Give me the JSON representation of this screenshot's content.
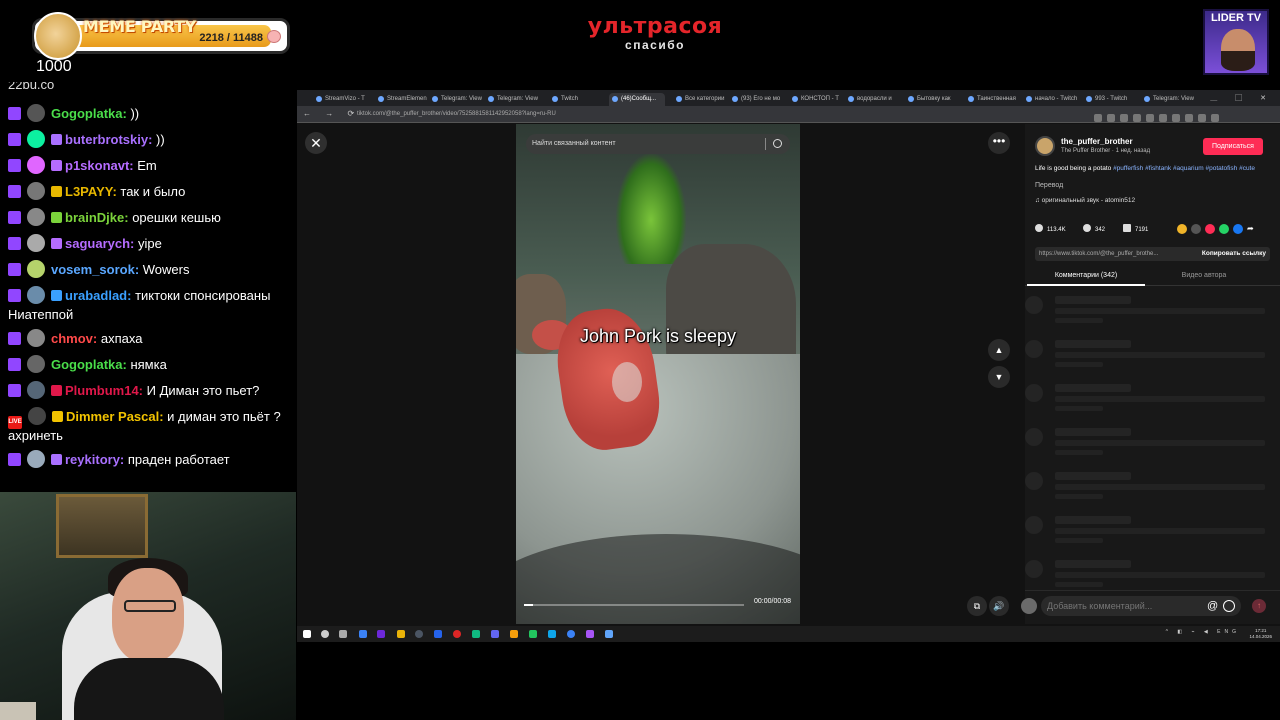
{
  "overlay": {
    "meme_title": "MEME PARTY",
    "meme_count": "2218 / 11488",
    "counter_value": "1000",
    "brand_title": "ультрасоя",
    "brand_subtitle": "спасибо",
    "channel_badge": "LIDER TV"
  },
  "chat": {
    "top_partial": "22bu.co",
    "messages": [
      {
        "user": "Gogoplatka",
        "color": "#4ade4a",
        "text": " ))"
      },
      {
        "user": "buterbrotskiy",
        "color": "#a970ff",
        "text": " ))"
      },
      {
        "user": "p1skonavt",
        "color": "#b56cff",
        "text": " Em"
      },
      {
        "user": "L3PAYY",
        "color": "#e8b800",
        "text": " так и было"
      },
      {
        "user": "brainDjke",
        "color": "#7bd33b",
        "text": " орешки кешью"
      },
      {
        "user": "saguarych",
        "color": "#b56cff",
        "text": " yipe"
      },
      {
        "user": "vosem_sorok",
        "color": "#5aa7ff",
        "text": " Wowers"
      },
      {
        "user": "urabadlad",
        "color": "#3aa0ff",
        "text": " тиктоки спонсированы",
        "cont": "Ниатеппой"
      },
      {
        "user": "chmov",
        "color": "#ff4a4a",
        "text": " ахпаха"
      },
      {
        "user": "Gogoplatka",
        "color": "#4ade4a",
        "text": " нямка"
      },
      {
        "user": "Plumbum14",
        "color": "#e0184a",
        "text": " И Диман это пьет?"
      },
      {
        "user": "Dimmer Pascal",
        "color": "#f2c300",
        "text": " и диман это пьёт ?",
        "cont": "ахринеть"
      },
      {
        "user": "reykitory",
        "color": "#a970ff",
        "text": " праден работает"
      }
    ]
  },
  "browser": {
    "tabs": [
      "StreamVizo - T",
      "StreamElemen",
      "Telegram: View",
      "Telegram: View",
      "Twitch",
      "(46)Сообщ...",
      "Все категории",
      "(93) Его не мо",
      "КОНСТОП - Т",
      "водорасли и",
      "Бытовку как",
      "Таинственная",
      "начало - Twitch",
      "993 - Twitch",
      "Telegram: View"
    ],
    "active_tab_index": 5,
    "url": "tiktok.com/@the_puffer_brother/video/7525881581142952058?lang=ru-RU"
  },
  "video": {
    "search_placeholder": "Найти связанный контент",
    "caption": "John Pork is sleepy",
    "time": "00:00/00:08",
    "progress_percent": 4
  },
  "sidebar": {
    "username": "the_puffer_brother",
    "meta": "The Puffer Brother · 1 нед. назад",
    "subscribe": "Подписаться",
    "desc_text": "Life is good being a potato ",
    "hashtags": [
      "#pufferfish",
      "#fishtank",
      "#aquarium",
      "#potatofish",
      "#cute"
    ],
    "translate": "Перевод",
    "music": "♫  оригинальный звук - atomin512",
    "likes": "113.4K",
    "comments": "342",
    "saves": "7191",
    "link": "https://www.tiktok.com/@the_puffer_brothe...",
    "copy_link": "Копировать ссылку",
    "tab_comments": "Комментарии (342)",
    "tab_videos": "Видео автора",
    "comment_placeholder": "Добавить комментарий..."
  },
  "taskbar": {
    "clock_time": "17:21",
    "clock_date": "14.04.2026",
    "lang": "ENG"
  },
  "colors": {
    "accent": "#fe2c55",
    "twitch": "#9146ff",
    "brand_red": "#e4252a"
  }
}
